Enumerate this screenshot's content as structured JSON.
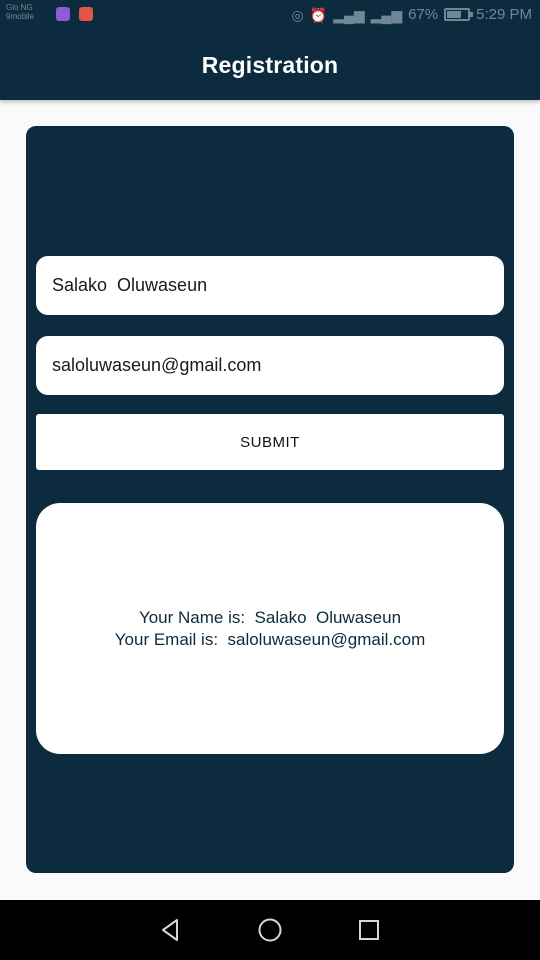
{
  "status_bar": {
    "left_text_1": "Glo NG",
    "left_text_2": "9mobile",
    "battery_percent": "67%",
    "time": "5:29 PM",
    "icons": [
      "vpn-key-icon",
      "alarm-icon",
      "signal-icon",
      "signal-icon",
      "battery-icon"
    ],
    "app_icon_colors": [
      "#8e5bd6",
      "#e0574a"
    ]
  },
  "app_bar": {
    "title": "Registration"
  },
  "form": {
    "name_value": "Salako  Oluwaseun",
    "email_value": "saloluwaseun@gmail.com",
    "submit_label": "SUBMIT"
  },
  "result": {
    "name_line": "Your Name is:  Salako  Oluwaseun",
    "email_line": "Your Email is:  saloluwaseun@gmail.com"
  },
  "nav_bar": {
    "icons": [
      "back-icon",
      "home-icon",
      "recents-icon"
    ]
  },
  "colors": {
    "primary": "#0c2b3e",
    "background": "#fafafa",
    "surface": "#ffffff"
  }
}
